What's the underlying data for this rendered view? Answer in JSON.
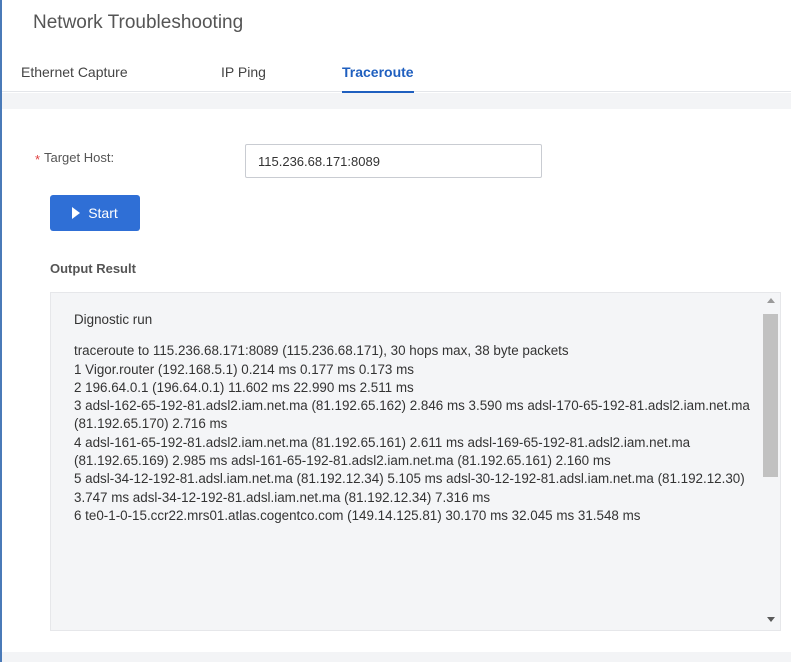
{
  "page": {
    "title": "Network Troubleshooting"
  },
  "tabs": [
    {
      "label": "Ethernet Capture",
      "active": false
    },
    {
      "label": "IP Ping",
      "active": false
    },
    {
      "label": "Traceroute",
      "active": true
    }
  ],
  "form": {
    "required_mark": "*",
    "target_host_label": "Target Host:",
    "target_host_value": "115.236.68.171:8089",
    "start_label": "Start"
  },
  "output": {
    "title": "Output Result",
    "heading": "Dignostic run",
    "lines": [
      "traceroute to 115.236.68.171:8089 (115.236.68.171), 30 hops max, 38 byte packets",
      "1 Vigor.router (192.168.5.1) 0.214 ms 0.177 ms 0.173 ms",
      "2 196.64.0.1 (196.64.0.1) 11.602 ms 22.990 ms 2.511 ms",
      "3 adsl-162-65-192-81.adsl2.iam.net.ma (81.192.65.162) 2.846 ms 3.590 ms adsl-170-65-192-81.adsl2.iam.net.ma (81.192.65.170) 2.716 ms",
      "4 adsl-161-65-192-81.adsl2.iam.net.ma (81.192.65.161) 2.611 ms adsl-169-65-192-81.adsl2.iam.net.ma (81.192.65.169) 2.985 ms adsl-161-65-192-81.adsl2.iam.net.ma (81.192.65.161) 2.160 ms",
      "5 adsl-34-12-192-81.adsl.iam.net.ma (81.192.12.34) 5.105 ms adsl-30-12-192-81.adsl.iam.net.ma (81.192.12.30) 3.747 ms adsl-34-12-192-81.adsl.iam.net.ma (81.192.12.34) 7.316 ms",
      "6 te0-1-0-15.ccr22.mrs01.atlas.cogentco.com (149.14.125.81) 30.170 ms 32.045 ms 31.548 ms"
    ]
  },
  "colors": {
    "accent": "#2f6fd6",
    "active_tab": "#1f5fbf",
    "required": "#e04040"
  },
  "icons": {
    "start": "play-icon",
    "scroll_up": "chevron-up-icon",
    "scroll_down": "chevron-down-icon"
  }
}
